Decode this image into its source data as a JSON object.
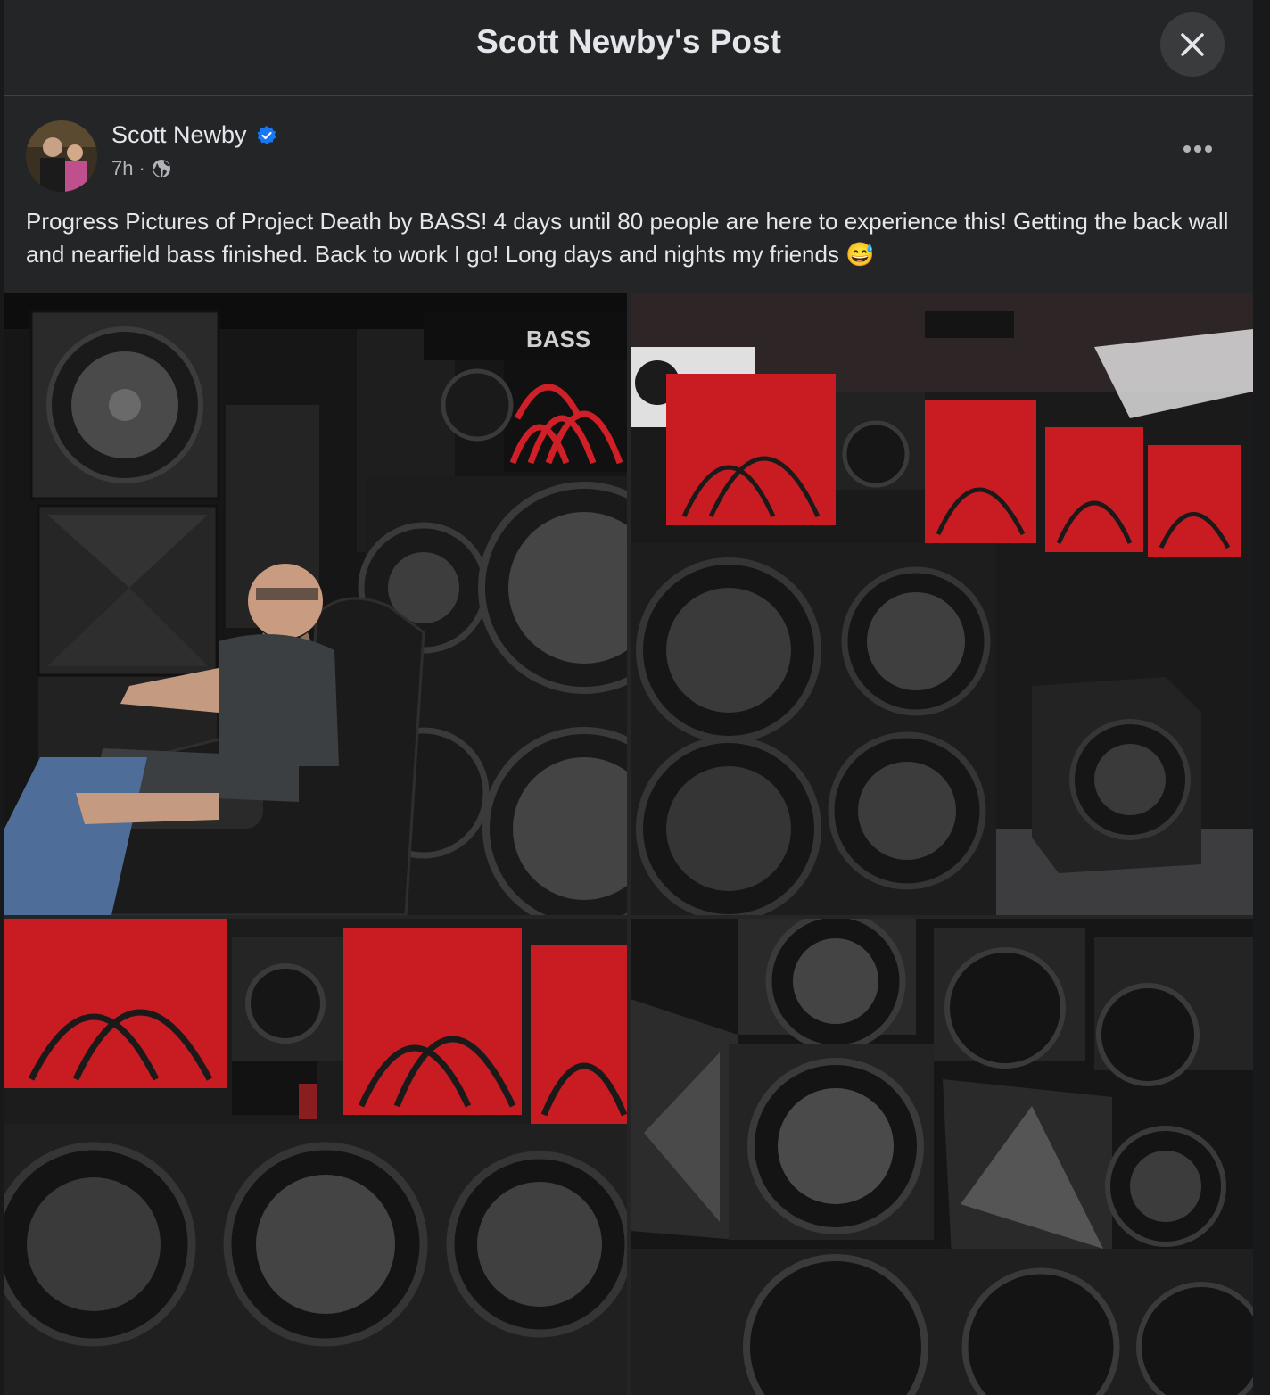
{
  "header": {
    "title": "Scott Newby's Post"
  },
  "post": {
    "author": "Scott Newby",
    "time": "7h",
    "separator": "·",
    "text": "Progress Pictures of Project Death by BASS! 4 days until 80 people are here to experience this! Getting the back wall and nearfield bass finished. Back to work I go! Long days and nights my friends 😅"
  },
  "photo_signage": "BASS",
  "colors": {
    "background": "#18191a",
    "card": "#242526",
    "text": "#e4e6eb",
    "secondary_text": "#b0b3b8",
    "verified_badge": "#1877f2",
    "panel_red": "#d01f26"
  },
  "icons": [
    "close-icon",
    "verified-badge-icon",
    "globe-icon",
    "more-options-icon"
  ]
}
